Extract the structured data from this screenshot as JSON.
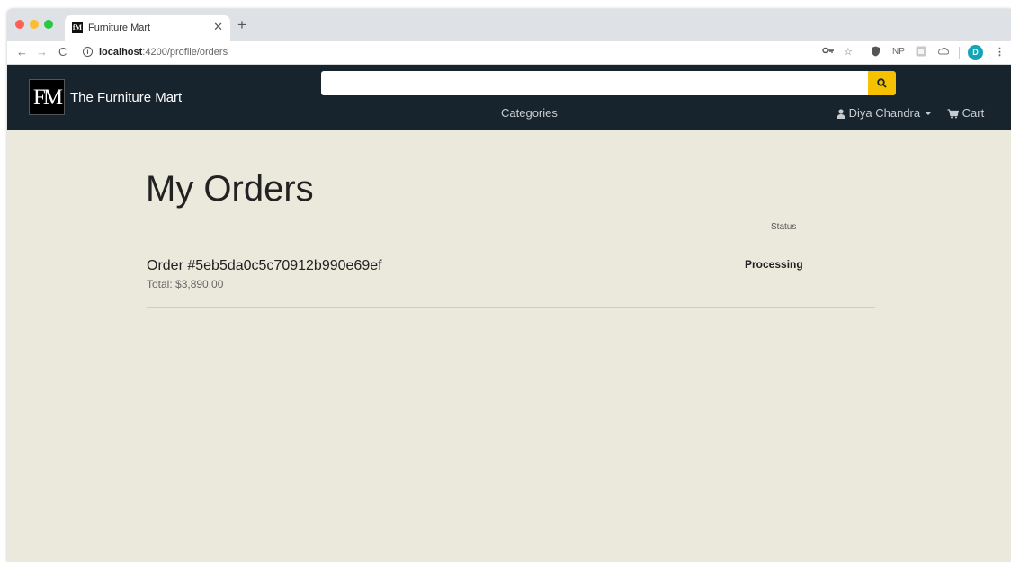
{
  "browser": {
    "tab_title": "Furniture Mart",
    "tab_favicon_text": "fM",
    "close_glyph": "✕",
    "new_tab_glyph": "+",
    "url_host": "localhost",
    "url_rest": ":4200/profile/orders",
    "profile_initial": "D",
    "ext_np": "NP"
  },
  "navbar": {
    "brand_name": "The Furniture Mart",
    "logo_text": "FM",
    "search_placeholder": "",
    "categories_label": "Categories",
    "user_name": "Diya Chandra",
    "cart_label": "Cart",
    "accent_color": "#f5c100",
    "bar_color": "#17232d"
  },
  "page": {
    "title": "My Orders",
    "status_column_header": "Status",
    "background_color": "#ebe8dc"
  },
  "orders": [
    {
      "title": "Order #5eb5da0c5c70912b990e69ef",
      "total": "Total: $3,890.00",
      "status": "Processing"
    }
  ]
}
